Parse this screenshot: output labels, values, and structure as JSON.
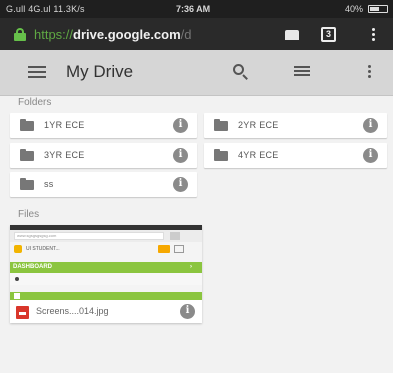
{
  "status_bar": {
    "signal_text": "G.ull 4G.ul 11.3K/s",
    "time": "7:36 AM",
    "right_text": "40%"
  },
  "browser": {
    "url_scheme": "https://",
    "url_host": "drive.google.com",
    "url_path": "/d",
    "tab_count": "3"
  },
  "app_bar": {
    "title": "My Drive"
  },
  "folders": {
    "section_label": "Folders",
    "items": [
      {
        "name": "1YR ECE"
      },
      {
        "name": "2YR ECE"
      },
      {
        "name": "3YR ECE"
      },
      {
        "name": "4YR ECE"
      },
      {
        "name": "ss"
      }
    ]
  },
  "files": {
    "section_label": "Files",
    "items": [
      {
        "name": "Screens....014.jpg",
        "thumbnail": {
          "url_text": "www.sgsgsgsgsg.com",
          "school_text": "UI STUDENT...",
          "dashboard_label": "DASHBOARD",
          "dashboard_caret": "›"
        }
      }
    ]
  },
  "colors": {
    "app_bar_bg": "#d6d6d6",
    "url_bar_bg": "#2a2a2a",
    "secure_green": "#66c04a",
    "dashboard_green": "#8bc53f",
    "image_icon_red": "#d9362b"
  }
}
